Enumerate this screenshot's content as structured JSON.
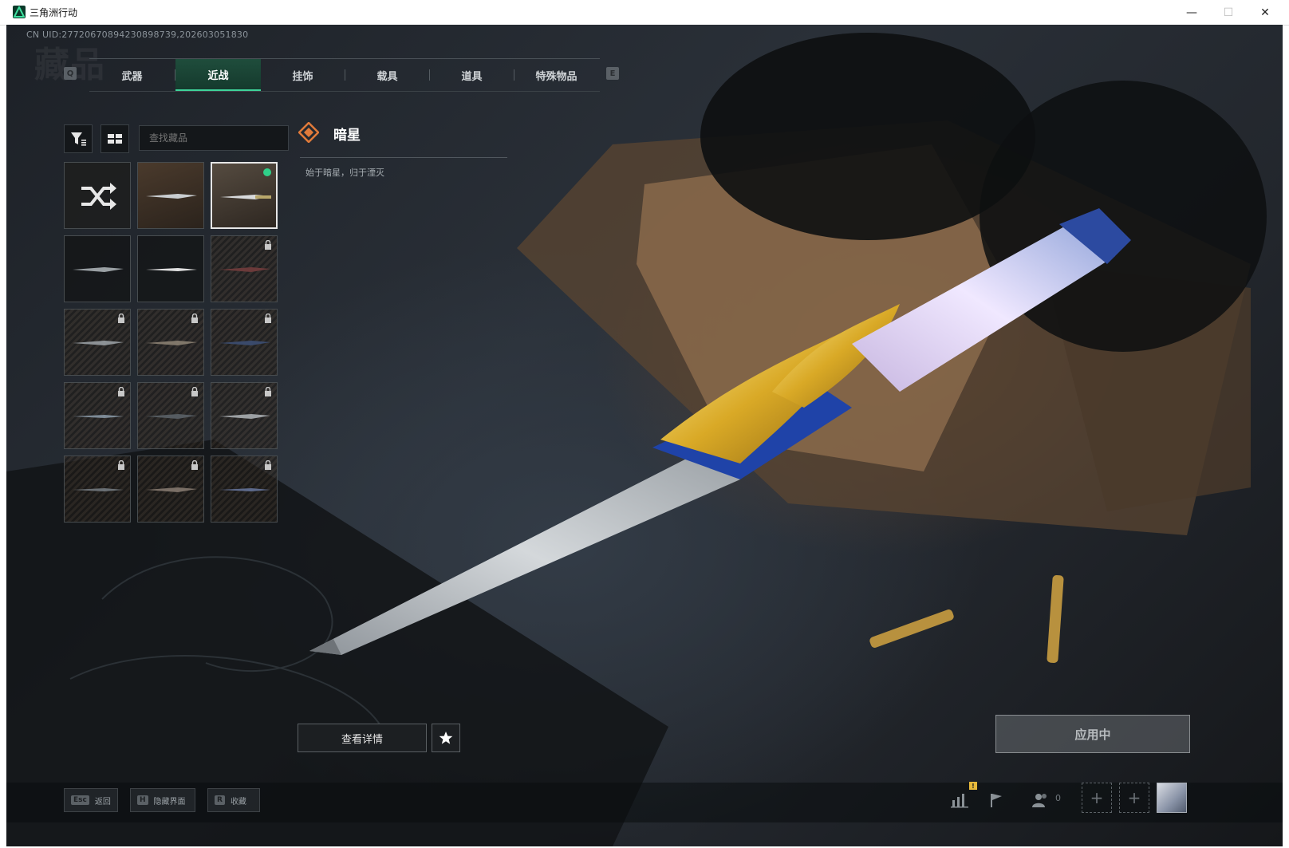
{
  "window": {
    "title": "三角洲行动"
  },
  "header": {
    "uid": "CN UID:2772067089423089873​9,202603051830",
    "page_title": "藏品"
  },
  "tabs": {
    "prev_key": "Q",
    "next_key": "E",
    "items": [
      {
        "label": "武器"
      },
      {
        "label": "近战"
      },
      {
        "label": "挂饰"
      },
      {
        "label": "载具"
      },
      {
        "label": "道具"
      },
      {
        "label": "特殊物品"
      }
    ],
    "active": "近战"
  },
  "toolbar": {
    "search_placeholder": "查找藏品"
  },
  "item": {
    "name": "暗星",
    "description": "始于暗星，归于湮灭"
  },
  "actions": {
    "detail_label": "查看详情",
    "apply_label": "应用中"
  },
  "bottom": {
    "hints": [
      {
        "key": "Esc",
        "label": "返回"
      },
      {
        "key": "H",
        "label": "隐藏界面"
      },
      {
        "key": "R",
        "label": "收藏"
      }
    ],
    "friends_count": "0",
    "badge": "!"
  },
  "colors": {
    "accent": "#3fd39a",
    "tab_active_bg": "#1f4d3c",
    "owned_dot": "#2fd089"
  }
}
